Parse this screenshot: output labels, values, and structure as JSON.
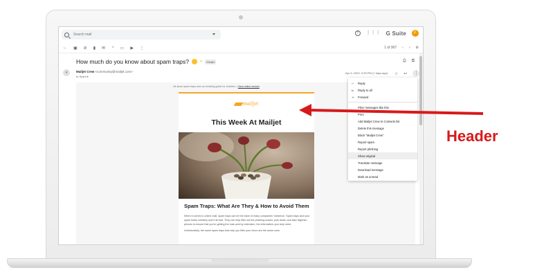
{
  "gmail": {
    "search_placeholder": "Search mail",
    "help_icon": "?",
    "apps_icon": "⋮⋮⋮",
    "brand": "G Suite",
    "avatar_initial": "F",
    "toolbar": {
      "icons": [
        "back-arrow-icon",
        "archive-icon",
        "spam-icon",
        "delete-icon",
        "mark-unread-icon",
        "snooze-icon",
        "move-to-icon",
        "label-icon",
        "more-icon"
      ],
      "pagination": "1 of 907"
    },
    "subject": "How much do you know about spam traps?",
    "label": "Mailjet",
    "sender_name": "Mailjet Crew",
    "sender_email": "<community@mailjet.com>",
    "recipient": "to Sushi",
    "date": "Apr 9, 2020, 3:39 PM (7 days ago)"
  },
  "email": {
    "preheader": "All about spam traps and our emailing guide for charities.",
    "preheader_link": "View online version",
    "logo_text": "mailjet",
    "headline": "This Week At Mailjet",
    "article_title": "Spam Traps: What Are They & How to Avoid Them",
    "paragraph_1": "When it comes to online mail, spam traps can be the bane of many companies' existence. Spam traps and your spam folder certainly aren't all bad. They can help filter out the phishing scams, junk deals, and fake Nigerian princes to ensure that you're getting the mail–and by extension, the information–you truly need.",
    "paragraph_2": "Unfortunately, the same spam traps that help you filter your inbox are the same ones"
  },
  "menu": {
    "items": [
      {
        "label": "Reply",
        "icon": "reply-icon"
      },
      {
        "label": "Reply to all",
        "icon": "reply-all-icon"
      },
      {
        "label": "Forward",
        "icon": "forward-icon"
      },
      {
        "label": "Filter messages like this"
      },
      {
        "label": "Print"
      },
      {
        "label": "Add Mailjet Crew to Contacts list"
      },
      {
        "label": "Delete this message"
      },
      {
        "label": "Block \"Mailjet Crew\""
      },
      {
        "label": "Report spam"
      },
      {
        "label": "Report phishing"
      },
      {
        "label": "Show original",
        "highlighted": true
      },
      {
        "label": "Translate message"
      },
      {
        "label": "Download message"
      },
      {
        "label": "Mark as unread"
      }
    ]
  },
  "callout": {
    "label": "Header",
    "color": "#d7191b"
  }
}
